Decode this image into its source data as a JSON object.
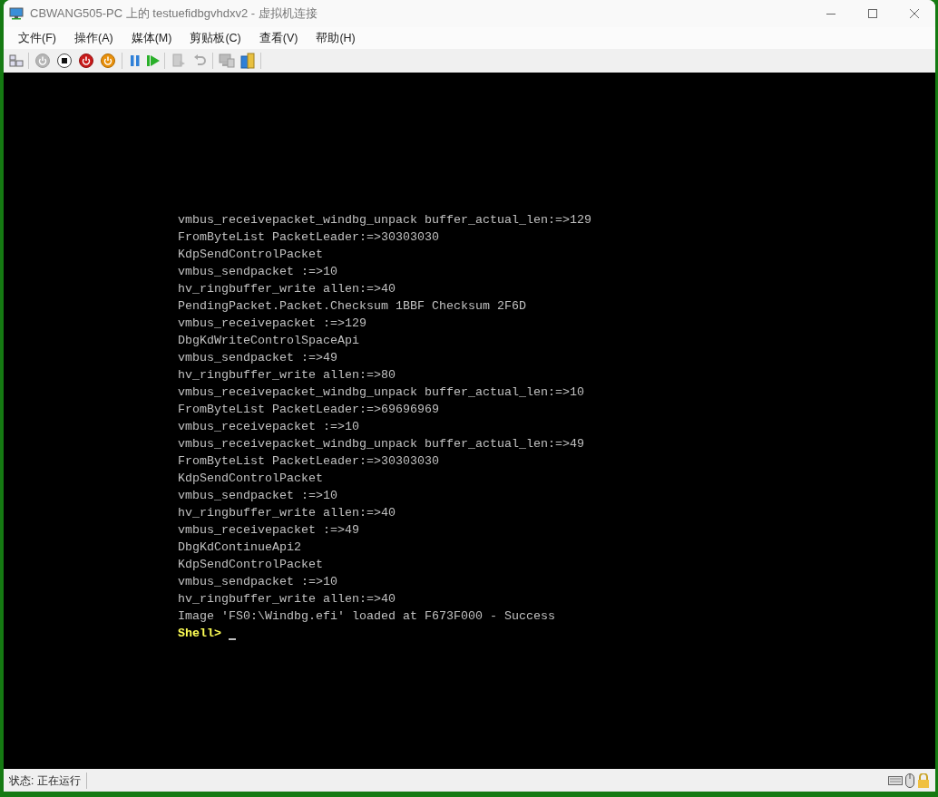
{
  "window": {
    "title": "CBWANG505-PC 上的 testuefidbgvhdxv2 - 虚拟机连接"
  },
  "menu": [
    "文件(F)",
    "操作(A)",
    "媒体(M)",
    "剪贴板(C)",
    "查看(V)",
    "帮助(H)"
  ],
  "console": {
    "lines": [
      {
        "kind": "output",
        "text": "vmbus_receivepacket_windbg_unpack buffer_actual_len:=>129"
      },
      {
        "kind": "output",
        "text": "FromByteList PacketLeader:=>30303030"
      },
      {
        "kind": "output",
        "text": "KdpSendControlPacket"
      },
      {
        "kind": "output",
        "text": "vmbus_sendpacket :=>10"
      },
      {
        "kind": "output",
        "text": "hv_ringbuffer_write allen:=>40"
      },
      {
        "kind": "output",
        "text": "PendingPacket.Packet.Checksum 1BBF Checksum 2F6D"
      },
      {
        "kind": "output",
        "text": "vmbus_receivepacket :=>129"
      },
      {
        "kind": "output",
        "text": "DbgKdWriteControlSpaceApi"
      },
      {
        "kind": "output",
        "text": "vmbus_sendpacket :=>49"
      },
      {
        "kind": "output",
        "text": "hv_ringbuffer_write allen:=>80"
      },
      {
        "kind": "output",
        "text": "vmbus_receivepacket_windbg_unpack buffer_actual_len:=>10"
      },
      {
        "kind": "output",
        "text": "FromByteList PacketLeader:=>69696969"
      },
      {
        "kind": "output",
        "text": "vmbus_receivepacket :=>10"
      },
      {
        "kind": "output",
        "text": "vmbus_receivepacket_windbg_unpack buffer_actual_len:=>49"
      },
      {
        "kind": "output",
        "text": "FromByteList PacketLeader:=>30303030"
      },
      {
        "kind": "output",
        "text": "KdpSendControlPacket"
      },
      {
        "kind": "output",
        "text": "vmbus_sendpacket :=>10"
      },
      {
        "kind": "output",
        "text": "hv_ringbuffer_write allen:=>40"
      },
      {
        "kind": "output",
        "text": "vmbus_receivepacket :=>49"
      },
      {
        "kind": "output",
        "text": "DbgKdContinueApi2"
      },
      {
        "kind": "output",
        "text": "KdpSendControlPacket"
      },
      {
        "kind": "output",
        "text": "vmbus_sendpacket :=>10"
      },
      {
        "kind": "output",
        "text": "hv_ringbuffer_write allen:=>40"
      },
      {
        "kind": "output",
        "text": "Image 'FS0:\\Windbg.efi' loaded at F673F000 - Success"
      },
      {
        "kind": "prompt",
        "text": "Shell>"
      }
    ]
  },
  "status_bar": {
    "text": "状态: 正在运行"
  }
}
